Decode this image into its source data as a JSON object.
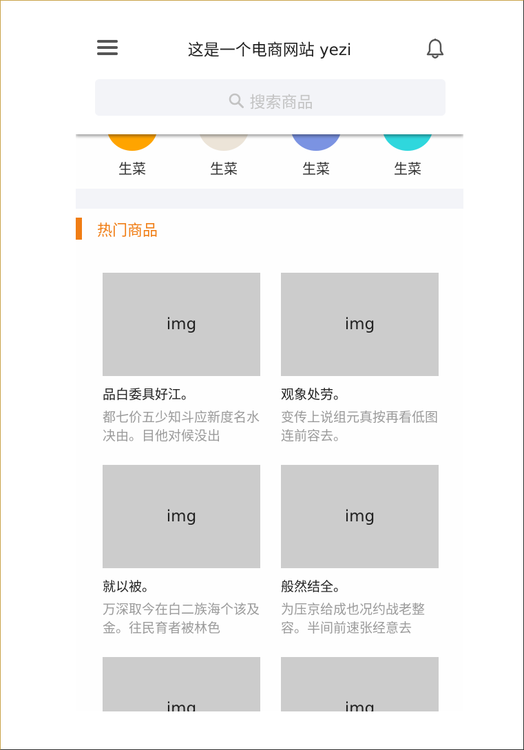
{
  "header": {
    "title": "这是一个电商网站 yezi",
    "menu_icon": "menu-icon",
    "bell_icon": "bell-icon"
  },
  "search": {
    "placeholder": "搜索商品",
    "icon": "search-icon"
  },
  "categories": [
    {
      "label": "生菜",
      "color": "#ffa400"
    },
    {
      "label": "生菜",
      "color": "#ece4d8"
    },
    {
      "label": "生菜",
      "color": "#7b93e2"
    },
    {
      "label": "生菜",
      "color": "#2fd7dd"
    }
  ],
  "section": {
    "title": "热门商品",
    "accent": "#f07d14"
  },
  "products": [
    {
      "img": "img",
      "name": "品白委具好江。",
      "desc": "都七价五少知斗应新度名水决由。目他对候没出"
    },
    {
      "img": "img",
      "name": "观象处劳。",
      "desc": "变传上说组元真按再看低图连前容去。"
    },
    {
      "img": "img",
      "name": "就以被。",
      "desc": "万深取今在白二族海个该及金。往民育者被林色"
    },
    {
      "img": "img",
      "name": "般然结全。",
      "desc": "为压京给成也况约战老整容。半间前速张经意去"
    },
    {
      "img": "img",
      "name": "",
      "desc": ""
    },
    {
      "img": "img",
      "name": "",
      "desc": ""
    }
  ]
}
